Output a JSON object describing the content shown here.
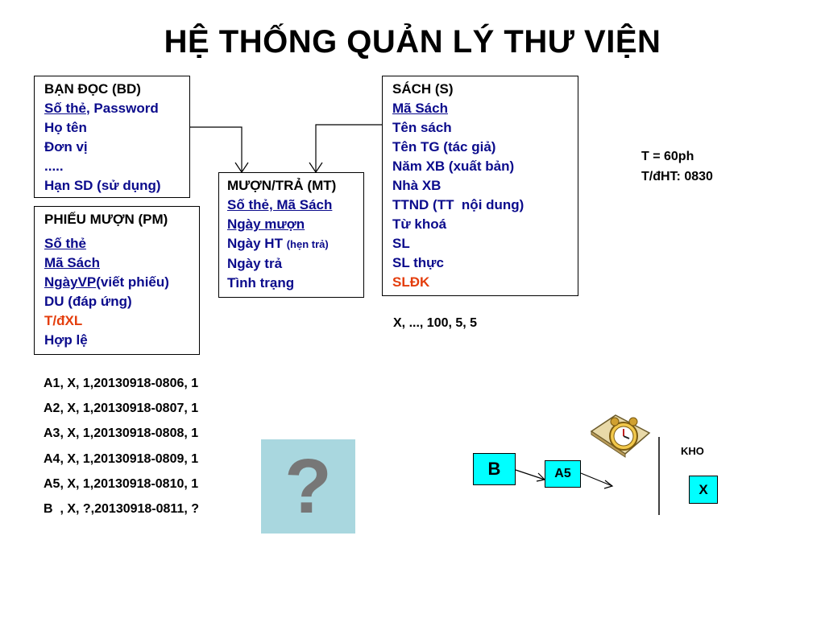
{
  "title": "HỆ THỐNG QUẢN LÝ THƯ VIỆN",
  "ban_doc": {
    "header": "BẠN ĐỌC (BD)",
    "key_so_the": "Số thẻ",
    "sep": ", Password",
    "ho_ten": "Họ tên",
    "don_vi": "Đơn vị",
    "dots": ".....",
    "han_sd": "Hạn SD (sử dụng)"
  },
  "phieu_muon": {
    "header": "PHIẾU MƯỢN (PM)",
    "so_the": "Số thẻ",
    "ma_sach": "Mã Sách",
    "ngay_vp": "NgàyVP",
    "ngay_vp_note": "(viết phiếu)",
    "du": "DU (đáp ứng)",
    "t_dxl": "T/đXL",
    "hop_le": "Hợp lệ"
  },
  "muon_tra": {
    "header": "MƯỢN/TRẢ (MT)",
    "key": "Số thẻ, Mã Sách",
    "ngay_muon": "Ngày mượn",
    "ngay_ht": "Ngày HT",
    "ngay_ht_note": "(hẹn trả)",
    "ngay_tra": "Ngày trả",
    "tinh_trang": "Tình trạng"
  },
  "sach": {
    "header": "SÁCH (S)",
    "ma_sach": "Mã Sách",
    "ten_sach": "Tên sách",
    "ten_tg": "Tên TG (tác giả)",
    "nam_xb": "Năm XB (xuất bản)",
    "nha_xb": "Nhà XB",
    "ttnd": "TTND (TT  nội dung)",
    "tu_khoa": "Từ khoá",
    "sl": "SL",
    "sl_thuc": "SL thực",
    "sldk": "SLĐK"
  },
  "notes": {
    "t": "T = 60ph",
    "t_dht": "T/đHT: 0830",
    "sample": "X, ..., 100, 5, 5"
  },
  "records": [
    "A1, X, 1,20130918-0806, 1",
    "A2, X, 1,20130918-0807, 1",
    "A3, X, 1,20130918-0808, 1",
    "A4, X, 1,20130918-0809, 1",
    "A5, X, 1,20130918-0810, 1",
    "B  , X, ?,20130918-0811, ?"
  ],
  "question_mark": "?",
  "flow": {
    "b": "B",
    "a5": "A5",
    "kho": "KHO",
    "x": "X"
  },
  "colors": {
    "blue_text": "#0b0b8c",
    "red_text": "#e43d0c",
    "question_bg": "#a9d7df",
    "flow_box": "#00ffff"
  },
  "icons": [
    "alarm-clock-icon"
  ]
}
